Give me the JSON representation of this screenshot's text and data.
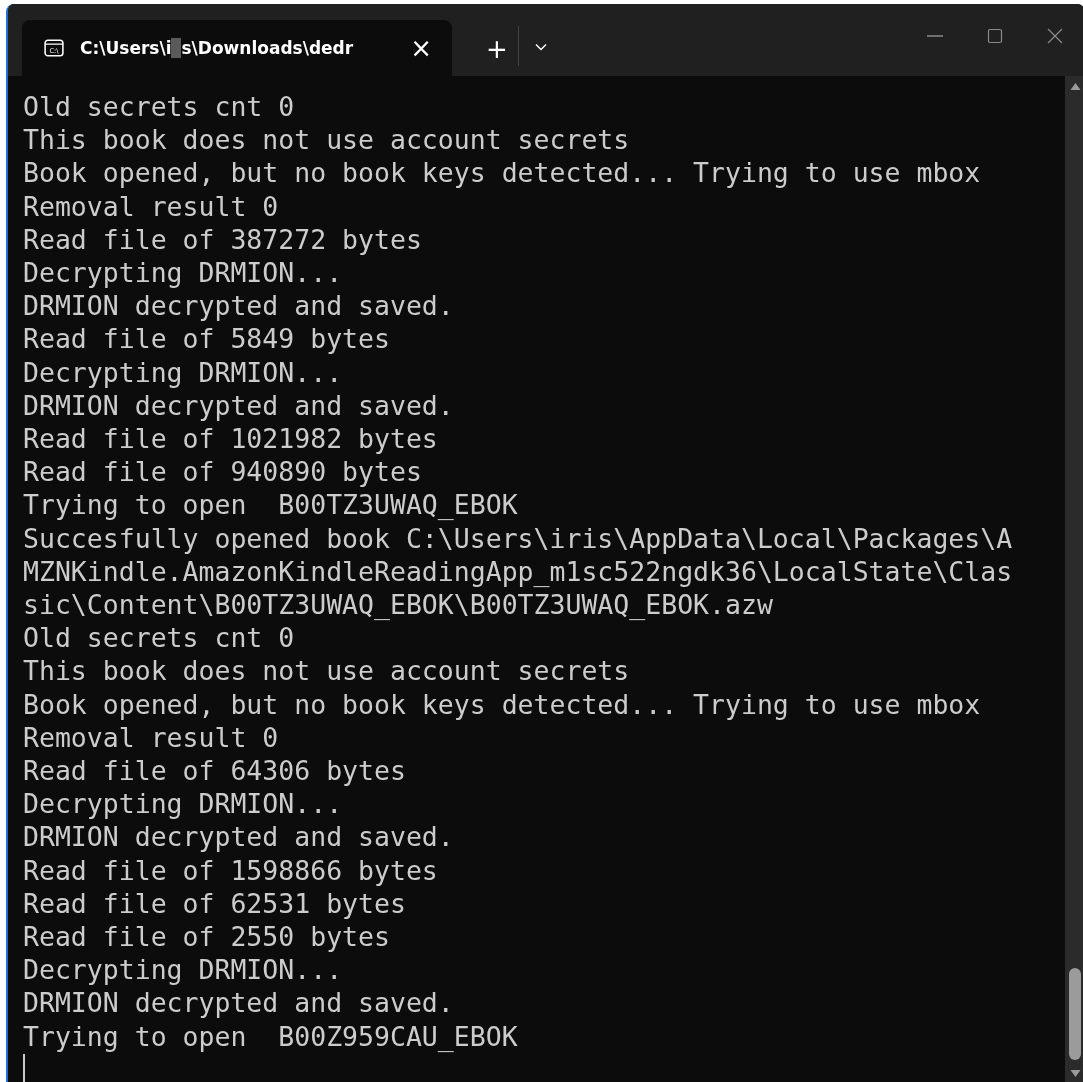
{
  "tab": {
    "icon_text": "C:\\",
    "title_start": "C:\\Users\\i",
    "title_end": "s\\Downloads\\dedr",
    "close": "×",
    "new_tab": "+",
    "selected": true
  },
  "lines": [
    "Old secrets cnt 0",
    "This book does not use account secrets",
    "Book opened, but no book keys detected... Trying to use mbox",
    "Removal result 0",
    "Read file of 387272 bytes",
    "Decrypting DRMION...",
    "DRMION decrypted and saved.",
    "Read file of 5849 bytes",
    "Decrypting DRMION...",
    "DRMION decrypted and saved.",
    "Read file of 1021982 bytes",
    "Read file of 940890 bytes",
    "Trying to open  B00TZ3UWAQ_EBOK",
    "Succesfully opened book C:\\Users\\iris\\AppData\\Local\\Packages\\A",
    "MZNKindle.AmazonKindleReadingApp_m1sc522ngdk36\\LocalState\\Clas",
    "sic\\Content\\B00TZ3UWAQ_EBOK\\B00TZ3UWAQ_EBOK.azw",
    "Old secrets cnt 0",
    "This book does not use account secrets",
    "Book opened, but no book keys detected... Trying to use mbox",
    "Removal result 0",
    "Read file of 64306 bytes",
    "Decrypting DRMION...",
    "DRMION decrypted and saved.",
    "Read file of 1598866 bytes",
    "Read file of 62531 bytes",
    "Read file of 2550 bytes",
    "Decrypting DRMION...",
    "DRMION decrypted and saved.",
    "Trying to open  B00Z959CAU_EBOK"
  ]
}
